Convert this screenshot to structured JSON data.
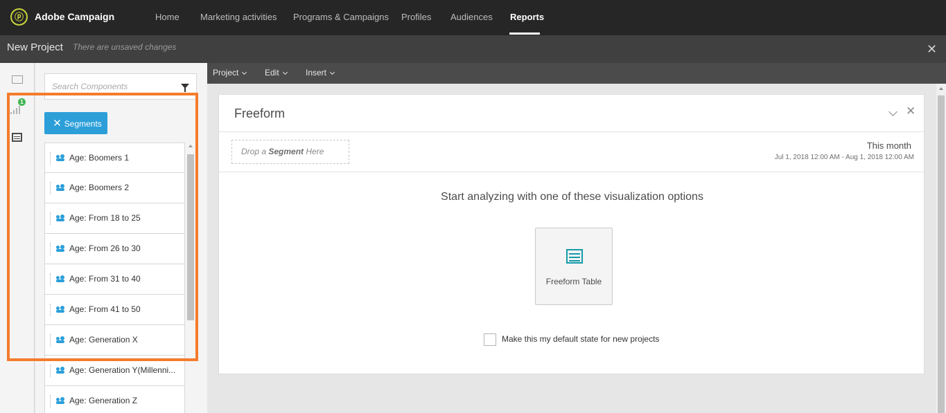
{
  "app": {
    "brand": "Adobe Campaign",
    "nav": [
      {
        "label": "Home",
        "active": false
      },
      {
        "label": "Marketing activities",
        "active": false
      },
      {
        "label": "Programs & Campaigns",
        "active": false
      },
      {
        "label": "Profiles",
        "active": false
      },
      {
        "label": "Audiences",
        "active": false
      },
      {
        "label": "Reports",
        "active": true
      }
    ]
  },
  "project": {
    "title": "New Project",
    "status": "There are unsaved changes",
    "close_icon": "close-icon"
  },
  "rail": {
    "metrics_badge": "1"
  },
  "components": {
    "search_placeholder": "Search Components",
    "segment_filter_label": "Segments",
    "segments": [
      "Age: Boomers 1",
      "Age: Boomers 2",
      "Age: From 18 to 25",
      "Age: From 26 to 30",
      "Age: From 31 to 40",
      "Age: From 41 to 50",
      "Age: Generation X",
      "Age: Generation Y(Millenni...",
      "Age: Generation Z"
    ]
  },
  "menubar": {
    "items": [
      "Project",
      "Edit",
      "Insert"
    ]
  },
  "freeform": {
    "title": "Freeform",
    "drop_prefix": "Drop a",
    "drop_bold": "Segment",
    "drop_suffix": "Here",
    "date_label": "This month",
    "date_range": "Jul 1, 2018 12:00 AM - Aug 1, 2018 12:00 AM",
    "start_text": "Start analyzing with one of these visualization options",
    "viz_option": "Freeform Table",
    "default_checkbox_label": "Make this my default state for new projects"
  },
  "colors": {
    "accent": "#2c9fd9",
    "highlight": "#f47c2c",
    "teal": "#149aaa",
    "brand_logo": "#c8d53a"
  }
}
